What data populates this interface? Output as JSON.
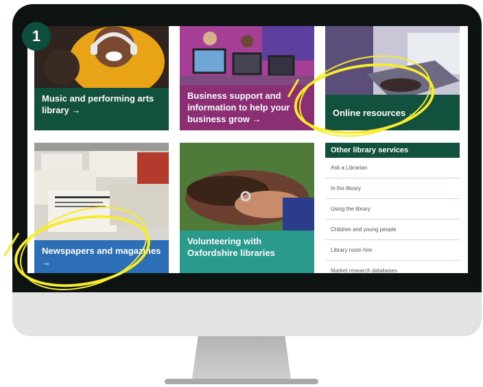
{
  "step_badge": "1",
  "tiles": [
    {
      "caption": "Music and performing arts library",
      "arrow": "→",
      "color": "#12513d"
    },
    {
      "caption": "Business support and information to help your business grow",
      "arrow": "→",
      "color": "#8b2e74"
    },
    {
      "caption": "Online resources",
      "arrow": "→",
      "color": "#12513d"
    },
    {
      "caption": "Newspapers and magazines",
      "arrow": "→",
      "color": "#2c6fb7"
    },
    {
      "caption": "Volunteering with Oxfordshire libraries",
      "arrow": "",
      "color": "#2a9a8c"
    }
  ],
  "sidebar": {
    "title": "Other library services",
    "items": [
      {
        "label": "Ask a Librarian"
      },
      {
        "label": "In the library"
      },
      {
        "label": "Using the library"
      },
      {
        "label": "Children and young people"
      },
      {
        "label": "Library room hire"
      },
      {
        "label": "Market research databases"
      }
    ]
  },
  "highlight_color": "#f7ec2b"
}
